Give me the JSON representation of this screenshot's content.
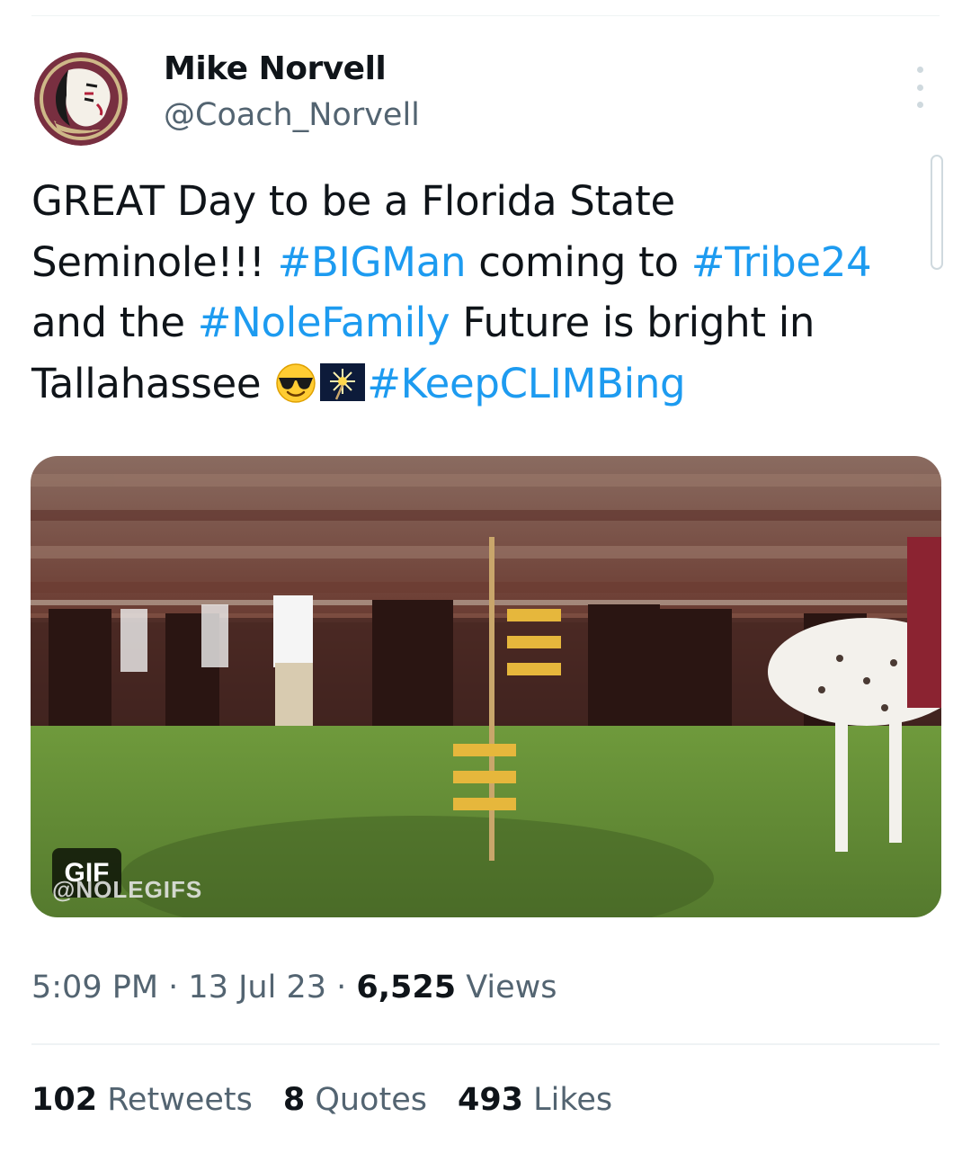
{
  "tweet": {
    "author": {
      "name": "Mike Norvell",
      "handle": "@Coach_Norvell",
      "avatar_icon": "seminole-logo-icon"
    },
    "text": {
      "line1": "GREAT Day to be a Florida State",
      "line2_a": "Seminole!!! ",
      "line2_tag1": "#BIGMan",
      "line2_b": " coming to ",
      "line2_tag2": "#Tribe24",
      "line3_a": "and the ",
      "line3_tag": "#NoleFamily",
      "line3_b": " Future is bright in",
      "line4_a": "Tallahassee ",
      "line4_emojis": [
        "smiling-face-with-sunglasses-emoji",
        "sparkler-emoji"
      ],
      "line4_tag": "#KeepCLIMBing"
    },
    "media": {
      "type": "gif",
      "badge": "GIF",
      "watermark": "@NOLEGIFS"
    },
    "meta": {
      "time": "5:09 PM",
      "separator": " · ",
      "date": "13 Jul 23",
      "views_count": "6,525",
      "views_label": " Views"
    },
    "stats": [
      {
        "count": "102",
        "label": " Retweets"
      },
      {
        "count": "8",
        "label": " Quotes"
      },
      {
        "count": "493",
        "label": " Likes"
      }
    ]
  },
  "colors": {
    "link": "#1d9bf0",
    "secondary_text": "#536471",
    "primary_text": "#0f1419",
    "divider": "#eff3f4"
  }
}
